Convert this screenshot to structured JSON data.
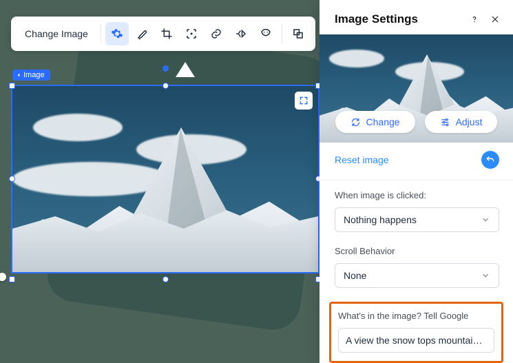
{
  "toolbar": {
    "change_image": "Change Image",
    "icons": {
      "settings": "gear-icon",
      "brush": "brush-icon",
      "crop": "crop-icon",
      "focal": "focal-icon",
      "link": "link-icon",
      "animation": "animation-icon",
      "mask": "mask-icon",
      "overlap": "overlap-icon"
    }
  },
  "selection": {
    "tag": "Image"
  },
  "panel": {
    "title": "Image Settings",
    "change": "Change",
    "adjust": "Adjust",
    "reset": "Reset image",
    "click": {
      "label": "When image is clicked:",
      "value": "Nothing happens"
    },
    "scroll": {
      "label": "Scroll Behavior",
      "value": "None"
    },
    "alt": {
      "label": "What's in the image? Tell Google",
      "value": "A view the snow tops mountais, ever…"
    }
  }
}
